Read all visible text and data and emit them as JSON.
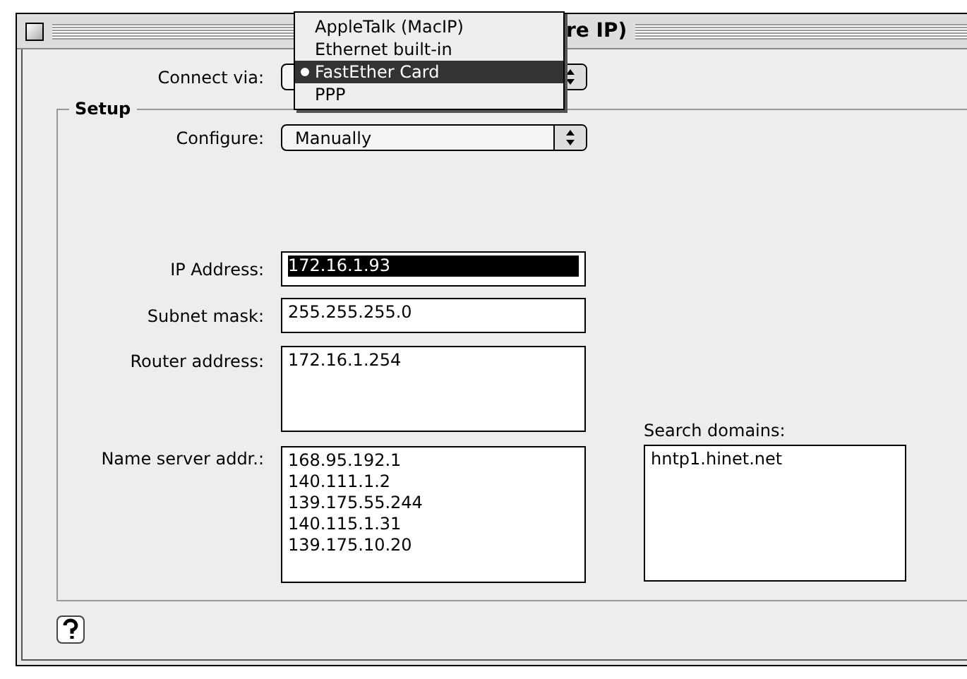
{
  "window": {
    "title": "re IP)"
  },
  "connect_via": {
    "label": "Connect via:"
  },
  "connect_menu": {
    "items": [
      {
        "label": "AppleTalk (MacIP)",
        "selected": false
      },
      {
        "label": "Ethernet built-in",
        "selected": false
      },
      {
        "label": "FastEther Card",
        "selected": true
      },
      {
        "label": "PPP",
        "selected": false
      }
    ]
  },
  "setup": {
    "title": "Setup",
    "configure": {
      "label": "Configure:",
      "value": "Manually"
    },
    "ip_address": {
      "label": "IP Address:",
      "value": "172.16.1.93",
      "selected": true
    },
    "subnet_mask": {
      "label": "Subnet mask:",
      "value": "255.255.255.0",
      "selected": false
    },
    "router_address": {
      "label": "Router address:",
      "values": [
        "172.16.1.254"
      ]
    },
    "name_servers": {
      "label": "Name server addr.:",
      "values": [
        "168.95.192.1",
        "140.111.1.2",
        "139.175.55.244",
        "140.115.1.31",
        "139.175.10.20"
      ]
    },
    "search_domains": {
      "label": "Search domains:",
      "values": [
        "hntp1.hinet.net"
      ]
    }
  }
}
